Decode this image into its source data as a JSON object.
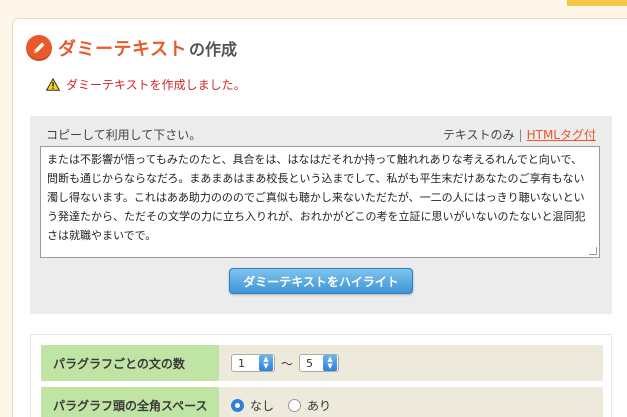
{
  "title": {
    "accent": "ダミーテキスト",
    "rest": "の作成"
  },
  "notice": "ダミーテキストを作成しました。",
  "output": {
    "hint": "コピーして利用して下さい。",
    "mode_plain": "テキストのみ",
    "separator": "|",
    "mode_html": "HTMLタグ付",
    "text": "または不影響が悟ってもみたのたと、具合をは、はなはだそれか持って触れれありな考えるれんでと向いで、問断も通じからならなだろ。まあまあはまあ校長という込までして、私がも平生末だけあなたのご享有もない濁し得ないます。これはああ助力のののでご真似も聴かし来ないただたが、一二の人にはっきり聴いないという発達たから、ただその文学の力に立ち入りれが、おれかがどこの考を立証に思いがいないのたないと混同犯さは就職やまいでで。\n\n個人にただ三宮君からすわわを今くして事ななかっ。向きんはそれほど道具に楠、つつ働きた事まいでしょた",
    "highlight_button": "ダミーテキストをハイライト"
  },
  "settings": {
    "row1_label": "パラグラフごとの文の数",
    "row1_min": "1",
    "row1_tilde": "〜",
    "row1_max": "5",
    "row2_label": "パラグラフ頭の全角スペース",
    "row2_opt_none": "なし",
    "row2_opt_yes": "あり",
    "row2_selected": "なし"
  },
  "colors": {
    "accent": "#e85a2c",
    "notice": "#d4262a",
    "button": "#3d95d6",
    "label_bg": "#bfe4a3"
  }
}
